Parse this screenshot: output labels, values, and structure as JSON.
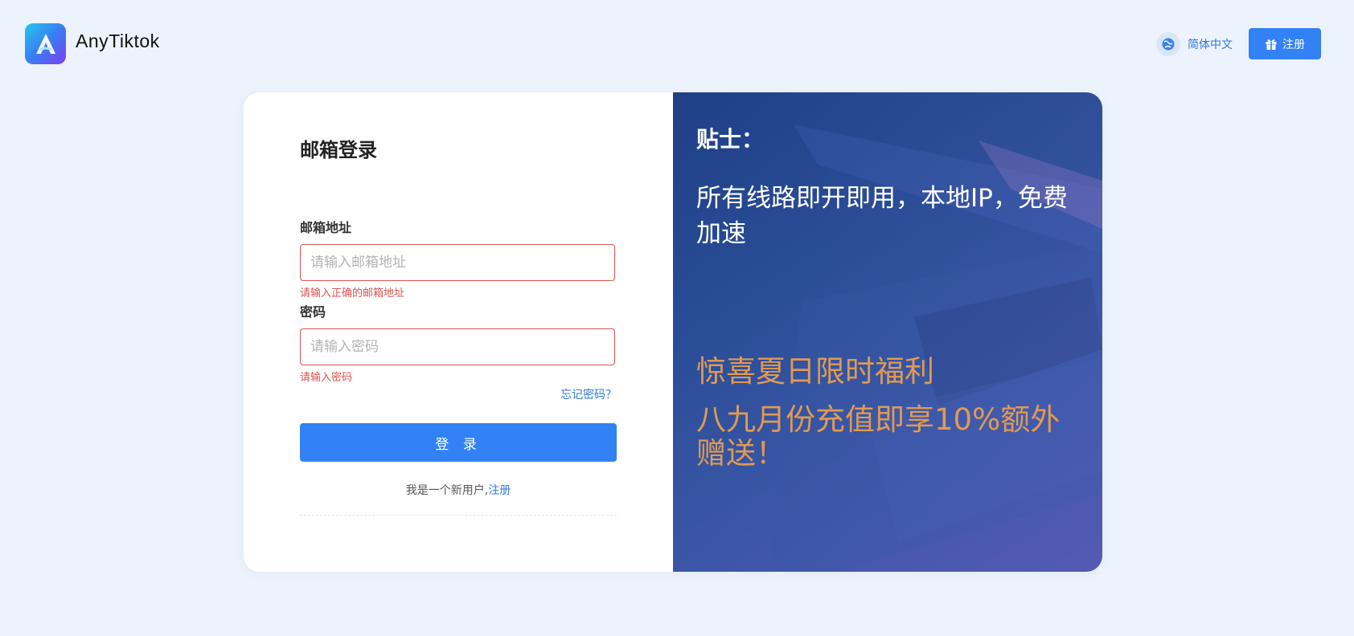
{
  "header": {
    "brand": "AnyTiktok",
    "logo_icon": "logo-a-icon",
    "language": {
      "label": "简体中文",
      "icon": "globe-icon"
    },
    "register_button": {
      "label": "注册",
      "icon": "gift-icon"
    }
  },
  "login": {
    "title": "邮箱登录",
    "email": {
      "label": "邮箱地址",
      "placeholder": "请输入邮箱地址",
      "error": "请输入正确的邮箱地址"
    },
    "password": {
      "label": "密码",
      "placeholder": "请输入密码",
      "error": "请输入密码"
    },
    "forgot": "忘记密码？",
    "submit": "登 录",
    "new_user_text": "我是一个新用户,",
    "new_user_link": "注册"
  },
  "tips": {
    "title": "贴士：",
    "text": "所有线路即开即用，本地IP，免费加速",
    "promo_title": "惊喜夏日限时福利",
    "promo_text": "八九月份充值即享10%额外赠送！"
  },
  "colors": {
    "primary": "#3282f6",
    "error": "#d9534f",
    "promo": "#e09a52",
    "panel": "#21478f",
    "background": "#edf3fc"
  }
}
